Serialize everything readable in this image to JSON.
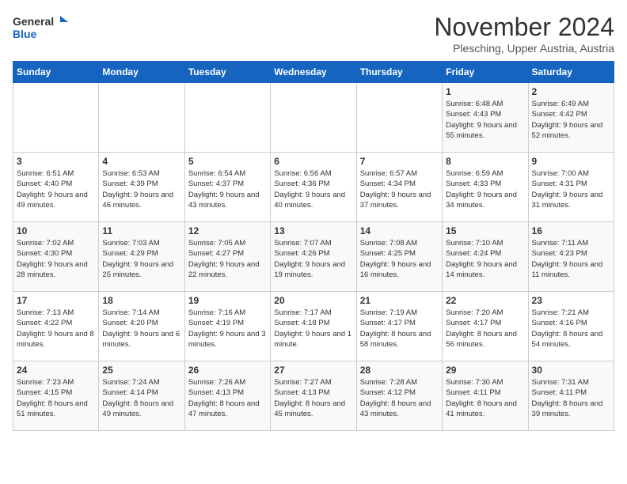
{
  "logo": {
    "general": "General",
    "blue": "Blue"
  },
  "title": "November 2024",
  "location": "Plesching, Upper Austria, Austria",
  "days_of_week": [
    "Sunday",
    "Monday",
    "Tuesday",
    "Wednesday",
    "Thursday",
    "Friday",
    "Saturday"
  ],
  "weeks": [
    [
      {
        "day": "",
        "detail": ""
      },
      {
        "day": "",
        "detail": ""
      },
      {
        "day": "",
        "detail": ""
      },
      {
        "day": "",
        "detail": ""
      },
      {
        "day": "",
        "detail": ""
      },
      {
        "day": "1",
        "detail": "Sunrise: 6:48 AM\nSunset: 4:43 PM\nDaylight: 9 hours and 55 minutes."
      },
      {
        "day": "2",
        "detail": "Sunrise: 6:49 AM\nSunset: 4:42 PM\nDaylight: 9 hours and 52 minutes."
      }
    ],
    [
      {
        "day": "3",
        "detail": "Sunrise: 6:51 AM\nSunset: 4:40 PM\nDaylight: 9 hours and 49 minutes."
      },
      {
        "day": "4",
        "detail": "Sunrise: 6:53 AM\nSunset: 4:39 PM\nDaylight: 9 hours and 46 minutes."
      },
      {
        "day": "5",
        "detail": "Sunrise: 6:54 AM\nSunset: 4:37 PM\nDaylight: 9 hours and 43 minutes."
      },
      {
        "day": "6",
        "detail": "Sunrise: 6:56 AM\nSunset: 4:36 PM\nDaylight: 9 hours and 40 minutes."
      },
      {
        "day": "7",
        "detail": "Sunrise: 6:57 AM\nSunset: 4:34 PM\nDaylight: 9 hours and 37 minutes."
      },
      {
        "day": "8",
        "detail": "Sunrise: 6:59 AM\nSunset: 4:33 PM\nDaylight: 9 hours and 34 minutes."
      },
      {
        "day": "9",
        "detail": "Sunrise: 7:00 AM\nSunset: 4:31 PM\nDaylight: 9 hours and 31 minutes."
      }
    ],
    [
      {
        "day": "10",
        "detail": "Sunrise: 7:02 AM\nSunset: 4:30 PM\nDaylight: 9 hours and 28 minutes."
      },
      {
        "day": "11",
        "detail": "Sunrise: 7:03 AM\nSunset: 4:29 PM\nDaylight: 9 hours and 25 minutes."
      },
      {
        "day": "12",
        "detail": "Sunrise: 7:05 AM\nSunset: 4:27 PM\nDaylight: 9 hours and 22 minutes."
      },
      {
        "day": "13",
        "detail": "Sunrise: 7:07 AM\nSunset: 4:26 PM\nDaylight: 9 hours and 19 minutes."
      },
      {
        "day": "14",
        "detail": "Sunrise: 7:08 AM\nSunset: 4:25 PM\nDaylight: 9 hours and 16 minutes."
      },
      {
        "day": "15",
        "detail": "Sunrise: 7:10 AM\nSunset: 4:24 PM\nDaylight: 9 hours and 14 minutes."
      },
      {
        "day": "16",
        "detail": "Sunrise: 7:11 AM\nSunset: 4:23 PM\nDaylight: 9 hours and 11 minutes."
      }
    ],
    [
      {
        "day": "17",
        "detail": "Sunrise: 7:13 AM\nSunset: 4:22 PM\nDaylight: 9 hours and 8 minutes."
      },
      {
        "day": "18",
        "detail": "Sunrise: 7:14 AM\nSunset: 4:20 PM\nDaylight: 9 hours and 6 minutes."
      },
      {
        "day": "19",
        "detail": "Sunrise: 7:16 AM\nSunset: 4:19 PM\nDaylight: 9 hours and 3 minutes."
      },
      {
        "day": "20",
        "detail": "Sunrise: 7:17 AM\nSunset: 4:18 PM\nDaylight: 9 hours and 1 minute."
      },
      {
        "day": "21",
        "detail": "Sunrise: 7:19 AM\nSunset: 4:17 PM\nDaylight: 8 hours and 58 minutes."
      },
      {
        "day": "22",
        "detail": "Sunrise: 7:20 AM\nSunset: 4:17 PM\nDaylight: 8 hours and 56 minutes."
      },
      {
        "day": "23",
        "detail": "Sunrise: 7:21 AM\nSunset: 4:16 PM\nDaylight: 8 hours and 54 minutes."
      }
    ],
    [
      {
        "day": "24",
        "detail": "Sunrise: 7:23 AM\nSunset: 4:15 PM\nDaylight: 8 hours and 51 minutes."
      },
      {
        "day": "25",
        "detail": "Sunrise: 7:24 AM\nSunset: 4:14 PM\nDaylight: 8 hours and 49 minutes."
      },
      {
        "day": "26",
        "detail": "Sunrise: 7:26 AM\nSunset: 4:13 PM\nDaylight: 8 hours and 47 minutes."
      },
      {
        "day": "27",
        "detail": "Sunrise: 7:27 AM\nSunset: 4:13 PM\nDaylight: 8 hours and 45 minutes."
      },
      {
        "day": "28",
        "detail": "Sunrise: 7:28 AM\nSunset: 4:12 PM\nDaylight: 8 hours and 43 minutes."
      },
      {
        "day": "29",
        "detail": "Sunrise: 7:30 AM\nSunset: 4:11 PM\nDaylight: 8 hours and 41 minutes."
      },
      {
        "day": "30",
        "detail": "Sunrise: 7:31 AM\nSunset: 4:11 PM\nDaylight: 8 hours and 39 minutes."
      }
    ]
  ]
}
